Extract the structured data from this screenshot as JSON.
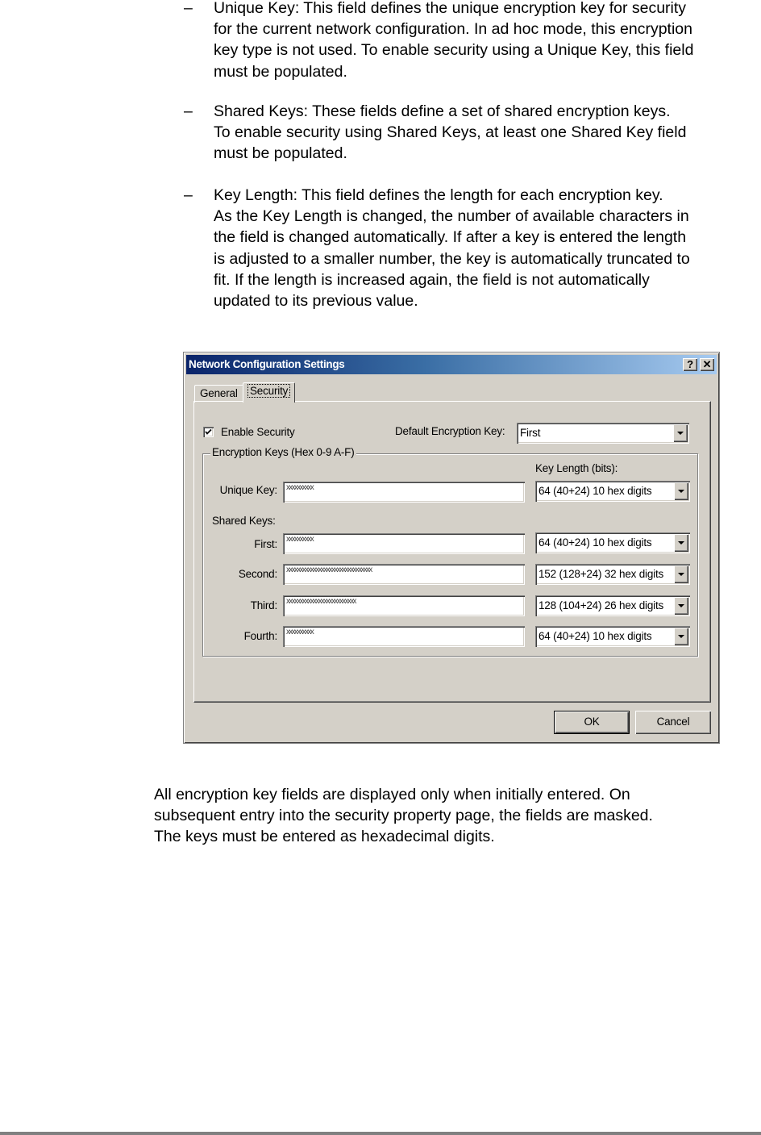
{
  "document": {
    "bullet_glyph": "–",
    "bullets": [
      {
        "lines": [
          "Unique Key: This field defines the unique encryption key for security",
          "for the current network configuration. In ad hoc mode, this encryption",
          "key type is not used. To enable security using a Unique Key, this field",
          "must be populated."
        ]
      },
      {
        "lines": [
          "Shared Keys: These fields define a set of shared encryption keys.",
          "To enable security using Shared Keys, at least one Shared Key field",
          "must be populated."
        ]
      },
      {
        "lines": [
          "Key Length: This field defines the length for each encryption key.",
          "As the Key Length is changed, the number of available characters in",
          "the field is changed automatically. If after a key is entered the length",
          "is adjusted to a smaller number, the key is automatically truncated to",
          "fit. If the length is increased again, the field is not automatically",
          "updated to its previous value."
        ]
      }
    ],
    "closing_paragraph": [
      "All encryption key fields are displayed only when initially entered. On",
      "subsequent entry into the security property page, the fields are masked.",
      "The keys must be entered as hexadecimal digits."
    ]
  },
  "dialog": {
    "title": "Network Configuration Settings",
    "help_button": "?",
    "close_button": "✕",
    "tabs": [
      {
        "label": "General",
        "active": false
      },
      {
        "label": "Security",
        "active": true
      }
    ],
    "enable_security": {
      "label": "Enable Security",
      "checked": true
    },
    "default_key": {
      "label": "Default Encryption Key:",
      "value": "First"
    },
    "group_title": "Encryption Keys (Hex 0-9 A-F)",
    "key_length_header": "Key Length (bits):",
    "shared_keys_label": "Shared Keys:",
    "keys": [
      {
        "label": "Unique Key:",
        "masked_value": "xxxxxxxxxx",
        "key_length": "64  (40+24)  10 hex digits"
      },
      {
        "label": "First:",
        "masked_value": "xxxxxxxxxx",
        "key_length": "64  (40+24)  10 hex digits"
      },
      {
        "label": "Second:",
        "masked_value": "xxxxxxxxxxxxxxxxxxxxxxxxxxxxxxxx",
        "key_length": "152 (128+24) 32 hex digits"
      },
      {
        "label": "Third:",
        "masked_value": "xxxxxxxxxxxxxxxxxxxxxxxxxx",
        "key_length": "128 (104+24) 26 hex digits"
      },
      {
        "label": "Fourth:",
        "masked_value": "xxxxxxxxxx",
        "key_length": "64  (40+24)  10 hex digits"
      }
    ],
    "ok_label": "OK",
    "cancel_label": "Cancel"
  }
}
